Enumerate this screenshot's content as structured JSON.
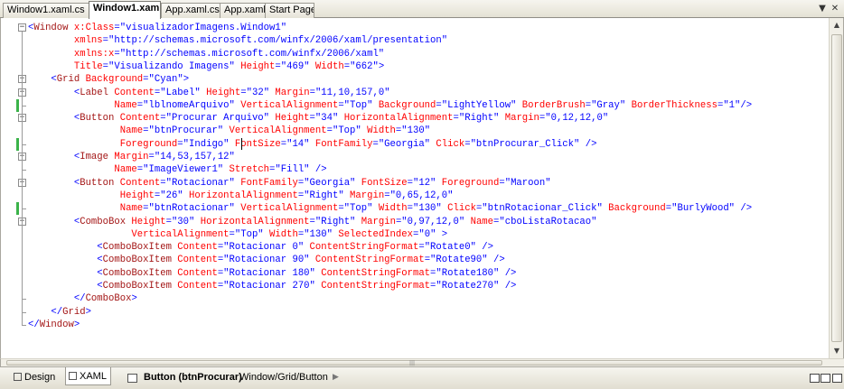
{
  "tabs": [
    {
      "label": "Window1.xaml.cs",
      "active": false
    },
    {
      "label": "Window1.xaml",
      "active": true
    },
    {
      "label": "App.xaml.cs",
      "active": false
    },
    {
      "label": "App.xaml",
      "active": false
    },
    {
      "label": "Start Page",
      "active": false
    }
  ],
  "tab_controls": {
    "dropdown_icon": "dropdown-arrow-icon",
    "close_icon": "close-icon",
    "close_glyph": "✕",
    "dropdown_glyph": "▼"
  },
  "code_lines": [
    [
      [
        "pun",
        "<"
      ],
      [
        "tag",
        "Window"
      ],
      [
        "attr",
        " x:Class"
      ],
      [
        "pun",
        "="
      ],
      [
        "val",
        "\"visualizadorImagens.Window1\""
      ]
    ],
    [
      [
        "attr",
        "        xmlns"
      ],
      [
        "pun",
        "="
      ],
      [
        "val",
        "\"http://schemas.microsoft.com/winfx/2006/xaml/presentation\""
      ]
    ],
    [
      [
        "attr",
        "        xmlns:x"
      ],
      [
        "pun",
        "="
      ],
      [
        "val",
        "\"http://schemas.microsoft.com/winfx/2006/xaml\""
      ]
    ],
    [
      [
        "attr",
        "        Title"
      ],
      [
        "pun",
        "="
      ],
      [
        "val",
        "\"Visualizando Imagens\""
      ],
      [
        "attr",
        " Height"
      ],
      [
        "pun",
        "="
      ],
      [
        "val",
        "\"469\""
      ],
      [
        "attr",
        " Width"
      ],
      [
        "pun",
        "="
      ],
      [
        "val",
        "\"662\""
      ],
      [
        "pun",
        ">"
      ]
    ],
    [
      [
        "pun",
        "    <"
      ],
      [
        "tag",
        "Grid"
      ],
      [
        "attr",
        " Background"
      ],
      [
        "pun",
        "="
      ],
      [
        "val",
        "\"Cyan\""
      ],
      [
        "pun",
        ">"
      ]
    ],
    [
      [
        "pun",
        "        <"
      ],
      [
        "tag",
        "Label"
      ],
      [
        "attr",
        " Content"
      ],
      [
        "pun",
        "="
      ],
      [
        "val",
        "\"Label\""
      ],
      [
        "attr",
        " Height"
      ],
      [
        "pun",
        "="
      ],
      [
        "val",
        "\"32\""
      ],
      [
        "attr",
        " Margin"
      ],
      [
        "pun",
        "="
      ],
      [
        "val",
        "\"11,10,157,0\""
      ]
    ],
    [
      [
        "attr",
        "               Name"
      ],
      [
        "pun",
        "="
      ],
      [
        "val",
        "\"lblnomeArquivo\""
      ],
      [
        "attr",
        " VerticalAlignment"
      ],
      [
        "pun",
        "="
      ],
      [
        "val",
        "\"Top\""
      ],
      [
        "attr",
        " Background"
      ],
      [
        "pun",
        "="
      ],
      [
        "val",
        "\"LightYellow\""
      ],
      [
        "attr",
        " BorderBrush"
      ],
      [
        "pun",
        "="
      ],
      [
        "val",
        "\"Gray\""
      ],
      [
        "attr",
        " BorderThickness"
      ],
      [
        "pun",
        "="
      ],
      [
        "val",
        "\"1\""
      ],
      [
        "pun",
        "/>"
      ]
    ],
    [
      [
        "pun",
        "        <"
      ],
      [
        "tag",
        "Button"
      ],
      [
        "attr",
        " Content"
      ],
      [
        "pun",
        "="
      ],
      [
        "val",
        "\"Procurar Arquivo\""
      ],
      [
        "attr",
        " Height"
      ],
      [
        "pun",
        "="
      ],
      [
        "val",
        "\"34\""
      ],
      [
        "attr",
        " HorizontalAlignment"
      ],
      [
        "pun",
        "="
      ],
      [
        "val",
        "\"Right\""
      ],
      [
        "attr",
        " Margin"
      ],
      [
        "pun",
        "="
      ],
      [
        "val",
        "\"0,12,12,0\""
      ]
    ],
    [
      [
        "attr",
        "                Name"
      ],
      [
        "pun",
        "="
      ],
      [
        "val",
        "\"btnProcurar\""
      ],
      [
        "attr",
        " VerticalAlignment"
      ],
      [
        "pun",
        "="
      ],
      [
        "val",
        "\"Top\""
      ],
      [
        "attr",
        " Width"
      ],
      [
        "pun",
        "="
      ],
      [
        "val",
        "\"130\""
      ]
    ],
    [
      [
        "attr",
        "                Foreground"
      ],
      [
        "pun",
        "="
      ],
      [
        "val",
        "\"Indigo\""
      ],
      [
        "attr",
        " FontSize"
      ],
      [
        "pun",
        "="
      ],
      [
        "val",
        "\"14\""
      ],
      [
        "attr",
        " FontFamily"
      ],
      [
        "pun",
        "="
      ],
      [
        "val",
        "\"Georgia\""
      ],
      [
        "attr",
        " Click"
      ],
      [
        "pun",
        "="
      ],
      [
        "val",
        "\"btnProcurar_Click\""
      ],
      [
        "pun",
        " />"
      ]
    ],
    [
      [
        "pun",
        "        <"
      ],
      [
        "tag",
        "Image"
      ],
      [
        "attr",
        " Margin"
      ],
      [
        "pun",
        "="
      ],
      [
        "val",
        "\"14,53,157,12\""
      ]
    ],
    [
      [
        "attr",
        "               Name"
      ],
      [
        "pun",
        "="
      ],
      [
        "val",
        "\"ImageViewer1\""
      ],
      [
        "attr",
        " Stretch"
      ],
      [
        "pun",
        "="
      ],
      [
        "val",
        "\"Fill\""
      ],
      [
        "pun",
        " />"
      ]
    ],
    [
      [
        "pun",
        "        <"
      ],
      [
        "tag",
        "Button"
      ],
      [
        "attr",
        " Content"
      ],
      [
        "pun",
        "="
      ],
      [
        "val",
        "\"Rotacionar\""
      ],
      [
        "attr",
        " FontFamily"
      ],
      [
        "pun",
        "="
      ],
      [
        "val",
        "\"Georgia\""
      ],
      [
        "attr",
        " FontSize"
      ],
      [
        "pun",
        "="
      ],
      [
        "val",
        "\"12\""
      ],
      [
        "attr",
        " Foreground"
      ],
      [
        "pun",
        "="
      ],
      [
        "val",
        "\"Maroon\""
      ]
    ],
    [
      [
        "attr",
        "                Height"
      ],
      [
        "pun",
        "="
      ],
      [
        "val",
        "\"26\""
      ],
      [
        "attr",
        " HorizontalAlignment"
      ],
      [
        "pun",
        "="
      ],
      [
        "val",
        "\"Right\""
      ],
      [
        "attr",
        " Margin"
      ],
      [
        "pun",
        "="
      ],
      [
        "val",
        "\"0,65,12,0\""
      ]
    ],
    [
      [
        "attr",
        "                Name"
      ],
      [
        "pun",
        "="
      ],
      [
        "val",
        "\"btnRotacionar\""
      ],
      [
        "attr",
        " VerticalAlignment"
      ],
      [
        "pun",
        "="
      ],
      [
        "val",
        "\"Top\""
      ],
      [
        "attr",
        " Width"
      ],
      [
        "pun",
        "="
      ],
      [
        "val",
        "\"130\""
      ],
      [
        "attr",
        " Click"
      ],
      [
        "pun",
        "="
      ],
      [
        "val",
        "\"btnRotacionar_Click\""
      ],
      [
        "attr",
        " Background"
      ],
      [
        "pun",
        "="
      ],
      [
        "val",
        "\"BurlyWood\""
      ],
      [
        "pun",
        " />"
      ]
    ],
    [
      [
        "pun",
        "        <"
      ],
      [
        "tag",
        "ComboBox"
      ],
      [
        "attr",
        " Height"
      ],
      [
        "pun",
        "="
      ],
      [
        "val",
        "\"30\""
      ],
      [
        "attr",
        " HorizontalAlignment"
      ],
      [
        "pun",
        "="
      ],
      [
        "val",
        "\"Right\""
      ],
      [
        "attr",
        " Margin"
      ],
      [
        "pun",
        "="
      ],
      [
        "val",
        "\"0,97,12,0\""
      ],
      [
        "attr",
        " Name"
      ],
      [
        "pun",
        "="
      ],
      [
        "val",
        "\"cboListaRotacao\""
      ]
    ],
    [
      [
        "attr",
        "                  VerticalAlignment"
      ],
      [
        "pun",
        "="
      ],
      [
        "val",
        "\"Top\""
      ],
      [
        "attr",
        " Width"
      ],
      [
        "pun",
        "="
      ],
      [
        "val",
        "\"130\""
      ],
      [
        "attr",
        " SelectedIndex"
      ],
      [
        "pun",
        "="
      ],
      [
        "val",
        "\"0\""
      ],
      [
        "pun",
        " >"
      ]
    ],
    [
      [
        "pun",
        "            <"
      ],
      [
        "tag",
        "ComboBoxItem"
      ],
      [
        "attr",
        " Content"
      ],
      [
        "pun",
        "="
      ],
      [
        "val",
        "\"Rotacionar 0\""
      ],
      [
        "attr",
        " ContentStringFormat"
      ],
      [
        "pun",
        "="
      ],
      [
        "val",
        "\"Rotate0\""
      ],
      [
        "pun",
        " />"
      ]
    ],
    [
      [
        "pun",
        "            <"
      ],
      [
        "tag",
        "ComboBoxItem"
      ],
      [
        "attr",
        " Content"
      ],
      [
        "pun",
        "="
      ],
      [
        "val",
        "\"Rotacionar 90\""
      ],
      [
        "attr",
        " ContentStringFormat"
      ],
      [
        "pun",
        "="
      ],
      [
        "val",
        "\"Rotate90\""
      ],
      [
        "pun",
        " />"
      ]
    ],
    [
      [
        "pun",
        "            <"
      ],
      [
        "tag",
        "ComboBoxItem"
      ],
      [
        "attr",
        " Content"
      ],
      [
        "pun",
        "="
      ],
      [
        "val",
        "\"Rotacionar 180\""
      ],
      [
        "attr",
        " ContentStringFormat"
      ],
      [
        "pun",
        "="
      ],
      [
        "val",
        "\"Rotate180\""
      ],
      [
        "pun",
        " />"
      ]
    ],
    [
      [
        "pun",
        "            <"
      ],
      [
        "tag",
        "ComboBoxItem"
      ],
      [
        "attr",
        " Content"
      ],
      [
        "pun",
        "="
      ],
      [
        "val",
        "\"Rotacionar 270\""
      ],
      [
        "attr",
        " ContentStringFormat"
      ],
      [
        "pun",
        "="
      ],
      [
        "val",
        "\"Rotate270\""
      ],
      [
        "pun",
        " />"
      ]
    ],
    [
      [
        "pun",
        "        </"
      ],
      [
        "tag",
        "ComboBox"
      ],
      [
        "pun",
        ">"
      ]
    ],
    [
      [
        "pun",
        "    </"
      ],
      [
        "tag",
        "Grid"
      ],
      [
        "pun",
        ">"
      ]
    ],
    [
      [
        "pun",
        "</"
      ],
      [
        "tag",
        "Window"
      ],
      [
        "pun",
        ">"
      ]
    ]
  ],
  "editor": {
    "cursor_line": 10,
    "cursor_col": 37
  },
  "bottom": {
    "design_label": "Design",
    "xaml_label": "XAML",
    "selected_element": "Button (btnProcurar)",
    "breadcrumb_path": "Window/Grid/Button",
    "breadcrumb_arrow": "▶",
    "scroll_up_glyph": "▲",
    "scroll_down_glyph": "▼",
    "scroll_grip_glyph": "|||"
  },
  "colors": {
    "tag": "#a31515",
    "attribute": "#ff0000",
    "value": "#0000ff",
    "punctuation": "#0000ff",
    "changed_marker": "#3bb34a"
  }
}
